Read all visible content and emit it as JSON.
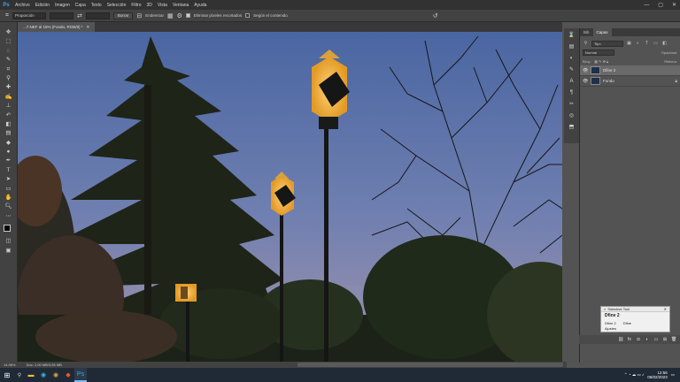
{
  "menubar": {
    "logo": "Ps",
    "items": [
      "Archivo",
      "Edición",
      "Imagen",
      "Capa",
      "Texto",
      "Selección",
      "Filtro",
      "3D",
      "Vista",
      "Ventana",
      "Ayuda"
    ],
    "controls": [
      "—",
      "▢",
      "✕"
    ]
  },
  "options": {
    "crop_ratio": "Proporción",
    "clear_button": "Borrar",
    "straighten_label": "Enderezar",
    "delete_cropped_label": "Eliminar píxeles recortados",
    "delete_cropped_checked": true,
    "content_aware_label": "Según el contenido",
    "content_aware_checked": false
  },
  "document": {
    "tab_title": "...7.NEF al 15% (Fondo, RGB/8) *",
    "close": "✕"
  },
  "status": {
    "zoom": "14,96%",
    "doc_info": "Doc: 1,00 MB/3,55 MB"
  },
  "layers_panel": {
    "tabs": [
      "Bib",
      "Capas"
    ],
    "active_tab": "Capas",
    "filter_label": "Tipo",
    "blend_label": "Normal",
    "opacity_label": "Opacidad:",
    "lock_label": "Bloq.:",
    "fill_label": "Relleno:",
    "layers": [
      {
        "name": "Dfine 2",
        "selected": true
      },
      {
        "name": "Fondo",
        "selected": false
      }
    ]
  },
  "properties": {
    "title": "Selective Tool",
    "header": "Dfine 2",
    "row_items": [
      "Dfine 2",
      "Dfine"
    ],
    "sub": "Ajustes"
  },
  "taskbar": {
    "time": "12:56",
    "date": "06/02/2023",
    "apps": [
      "explorer",
      "edge",
      "chrome",
      "brave",
      "photoshop"
    ],
    "active_app": "photoshop"
  },
  "colors": {
    "sky_top": "#4f6aa3",
    "sky_bottom": "#9a8ca6",
    "lamp_glow": "#e9a52b",
    "ps_blue": "#31a8ff"
  }
}
